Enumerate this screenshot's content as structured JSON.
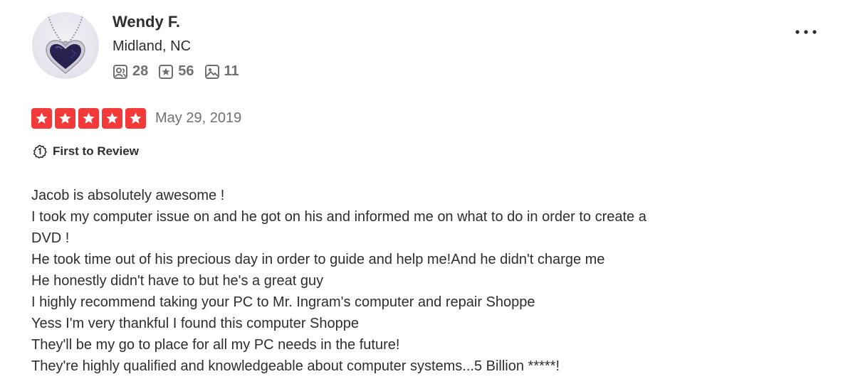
{
  "user": {
    "name": "Wendy F.",
    "location": "Midland, NC",
    "stats": {
      "friends": "28",
      "reviews": "56",
      "photos": "11"
    }
  },
  "review": {
    "rating": 5,
    "date": "May 29, 2019",
    "badge": "First to Review",
    "lines": [
      "Jacob is absolutely awesome !",
      "I took my computer issue on and he got on his and informed me on what to do in order to create a",
      "DVD !",
      "He took time out of his precious day in order to guide and help me!And he didn't charge me",
      "He honestly didn't have to but he's a great guy",
      "I highly recommend taking your PC to Mr. Ingram's computer and repair Shoppe",
      "Yess I'm very thankful I found this computer Shoppe",
      "They'll be my go to place for all my PC needs in the future!",
      "They're highly qualified and knowledgeable about computer systems...5 Billion *****!"
    ]
  },
  "icons": {
    "friends": "friends-icon",
    "reviews": "review-star-icon",
    "photos": "photo-icon",
    "more": "more-options-icon",
    "badge": "first-review-icon"
  },
  "colors": {
    "star": "#f43939",
    "text": "#2d2e2f",
    "muted": "#6e7072"
  }
}
